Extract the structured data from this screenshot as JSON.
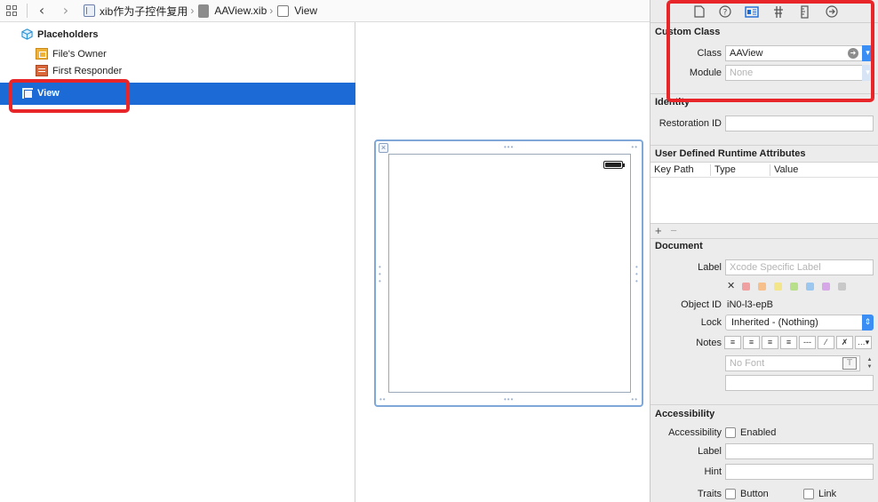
{
  "jumpbar": {
    "crumbs": [
      "xib作为子控件复用",
      "AAView.xib",
      "View"
    ]
  },
  "outline": {
    "placeholders_label": "Placeholders",
    "files_owner_label": "File's Owner",
    "first_responder_label": "First Responder",
    "view_label": "View"
  },
  "inspector": {
    "custom_class": {
      "title": "Custom Class",
      "class_label": "Class",
      "class_value": "AAView",
      "module_label": "Module",
      "module_placeholder": "None"
    },
    "identity": {
      "title": "Identity",
      "restoration_id_label": "Restoration ID"
    },
    "udra": {
      "title": "User Defined Runtime Attributes",
      "columns": [
        "Key Path",
        "Type",
        "Value"
      ],
      "add_symbol": "+",
      "remove_symbol": "−"
    },
    "document": {
      "title": "Document",
      "label_label": "Label",
      "label_placeholder": "Xcode Specific Label",
      "clear_symbol": "✕",
      "swatch_colors": [
        "#f0a0a0",
        "#f7c08a",
        "#f3e58a",
        "#b8e08a",
        "#9cc8f0",
        "#d6a8e8",
        "#c8c8c8"
      ],
      "object_id_label": "Object ID",
      "object_id_value": "iN0-l3-epB",
      "lock_label": "Lock",
      "lock_value": "Inherited - (Nothing)",
      "notes_label": "Notes",
      "font_placeholder": "No Font"
    },
    "accessibility": {
      "title": "Accessibility",
      "accessibility_label": "Accessibility",
      "enabled_label": "Enabled",
      "label_label": "Label",
      "hint_label": "Hint",
      "traits_label": "Traits",
      "button_label": "Button",
      "link_label": "Link"
    }
  },
  "colors": {
    "selection": "#1b6ad6",
    "highlight": "#e8262a",
    "scene_border": "#7fa8d9"
  }
}
